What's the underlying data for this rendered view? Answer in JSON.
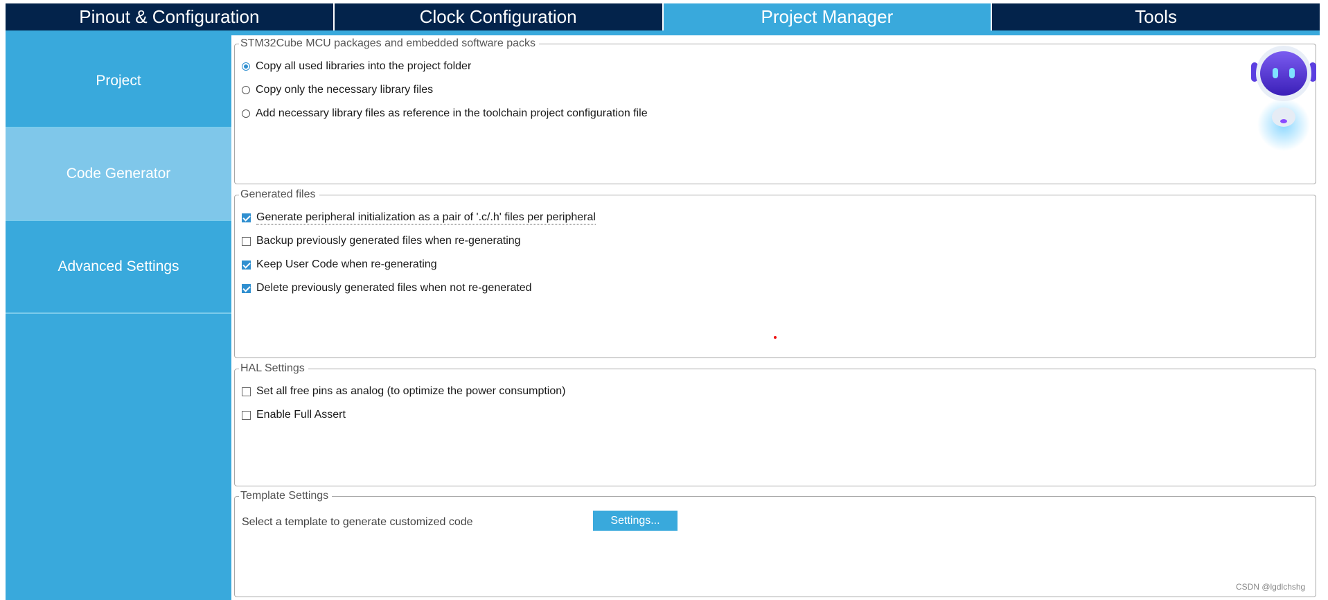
{
  "top_tabs": [
    {
      "label": "Pinout & Configuration"
    },
    {
      "label": "Clock Configuration"
    },
    {
      "label": "Project Manager"
    },
    {
      "label": "Tools"
    }
  ],
  "active_tab": "Project Manager",
  "sidebar": {
    "items": [
      {
        "label": "Project"
      },
      {
        "label": "Code Generator"
      },
      {
        "label": "Advanced Settings"
      }
    ],
    "active": "Code Generator"
  },
  "packages": {
    "legend": "STM32Cube MCU packages and embedded software packs",
    "options": [
      {
        "label": "Copy all used libraries into the project folder",
        "selected": true
      },
      {
        "label": "Copy only the necessary library files",
        "selected": false
      },
      {
        "label": "Add necessary library files as reference in the toolchain project configuration file",
        "selected": false
      }
    ]
  },
  "generated_files": {
    "legend": "Generated files",
    "options": [
      {
        "label": "Generate peripheral initialization as a pair of '.c/.h' files per peripheral",
        "checked": true
      },
      {
        "label": "Backup previously generated files when re-generating",
        "checked": false
      },
      {
        "label": "Keep User Code when re-generating",
        "checked": true
      },
      {
        "label": "Delete previously generated files when not re-generated",
        "checked": true
      }
    ]
  },
  "hal_settings": {
    "legend": "HAL Settings",
    "options": [
      {
        "label": "Set all free pins as analog (to optimize the power consumption)",
        "checked": false
      },
      {
        "label": "Enable Full Assert",
        "checked": false
      }
    ]
  },
  "template_settings": {
    "legend": "Template Settings",
    "label": "Select a template to generate customized code",
    "button": "Settings..."
  },
  "watermark": "CSDN @lgdlchshg",
  "colors": {
    "navy": "#03234b",
    "accent": "#39a9dc",
    "sidebar_active": "#7fc7ea",
    "check": "#2f8fd0"
  }
}
